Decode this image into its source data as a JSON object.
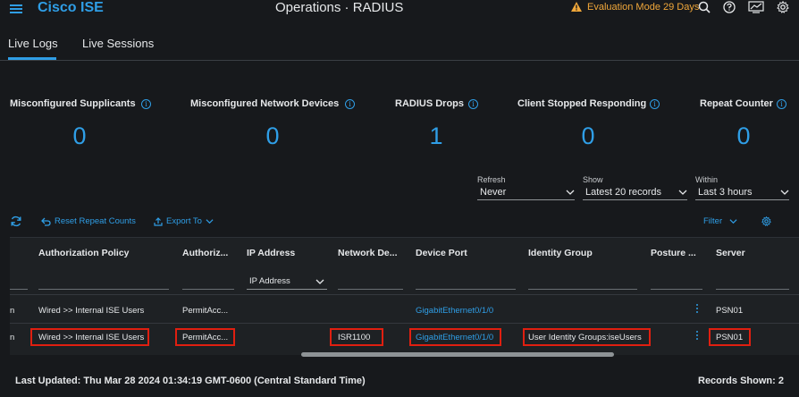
{
  "header": {
    "brand": "Cisco ISE",
    "title": "Operations · RADIUS",
    "evaluation": "Evaluation Mode 29 Days"
  },
  "tabs": [
    {
      "label": "Live Logs",
      "active": true
    },
    {
      "label": "Live Sessions",
      "active": false
    }
  ],
  "kpis": [
    {
      "label": "Misconfigured Supplicants",
      "value": "0"
    },
    {
      "label": "Misconfigured Network Devices",
      "value": "0"
    },
    {
      "label": "RADIUS Drops",
      "value": "1"
    },
    {
      "label": "Client Stopped Responding",
      "value": "0"
    },
    {
      "label": "Repeat Counter",
      "value": "0"
    }
  ],
  "selects": {
    "refresh": {
      "label": "Refresh",
      "value": "Never"
    },
    "show": {
      "label": "Show",
      "value": "Latest 20 records"
    },
    "within": {
      "label": "Within",
      "value": "Last 3 hours"
    }
  },
  "toolbar": {
    "reset": "Reset Repeat Counts",
    "export": "Export To",
    "filter": "Filter"
  },
  "table": {
    "columns": [
      "Authorization Policy",
      "Authoriz...",
      "IP Address",
      "Network De...",
      "Device Port",
      "Identity Group",
      "Posture ...",
      "Server"
    ],
    "ip_filter": "IP Address",
    "rows": [
      {
        "first": "n",
        "authz_policy": "Wired >> Internal ISE Users",
        "authz_profile": "PermitAcc...",
        "ip": "",
        "network_device": "",
        "device_port": "GigabitEthernet0/1/0",
        "identity_group": "",
        "posture": "",
        "server": "PSN01"
      },
      {
        "first": "n",
        "authz_policy": "Wired >> Internal ISE Users",
        "authz_profile": "PermitAcc...",
        "ip": "",
        "network_device": "ISR1100",
        "device_port": "GigabitEthernet0/1/0",
        "identity_group": "User Identity Groups:iseUsers",
        "posture": "",
        "server": "PSN01"
      }
    ]
  },
  "footer": {
    "last_updated": "Last Updated: Thu Mar 28 2024 01:34:19 GMT-0600 (Central Standard Time)",
    "records_shown": "Records Shown: 2"
  },
  "colors": {
    "background": "#17191c",
    "accent": "#2f9ee6",
    "warning": "#f0a73a",
    "highlight": "#e01f10"
  },
  "icons": {
    "menu": "hamburger-menu-icon",
    "warning": "warning-triangle-icon",
    "search": "search-icon",
    "help": "help-icon",
    "dashboard": "dashboard-icon",
    "settings": "gear-icon"
  }
}
